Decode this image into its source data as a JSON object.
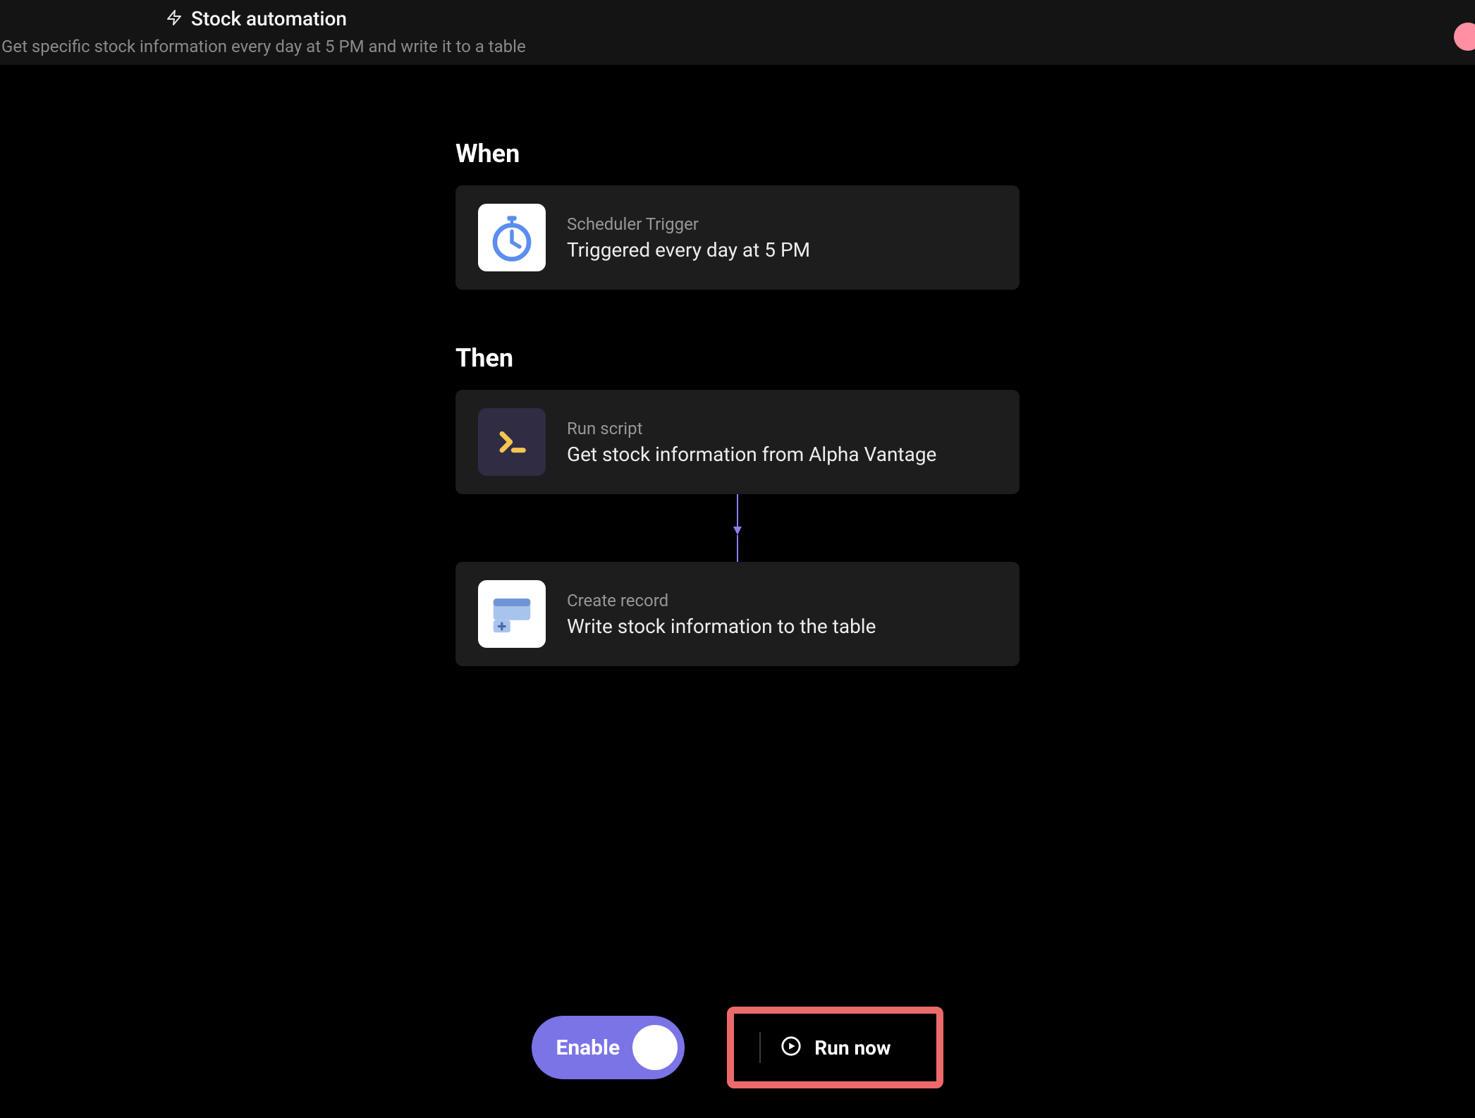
{
  "header": {
    "title": "Stock automation",
    "subtitle": "Get specific stock information every day at 5 PM and write it to a table"
  },
  "sections": {
    "when_heading": "When",
    "then_heading": "Then"
  },
  "trigger": {
    "label": "Scheduler Trigger",
    "desc": "Triggered every day at 5 PM"
  },
  "actions": [
    {
      "label": "Run script",
      "desc": "Get stock information from Alpha Vantage"
    },
    {
      "label": "Create record",
      "desc": "Write stock information to the table"
    }
  ],
  "bottom": {
    "enable_label": "Enable",
    "run_now_label": "Run now"
  }
}
